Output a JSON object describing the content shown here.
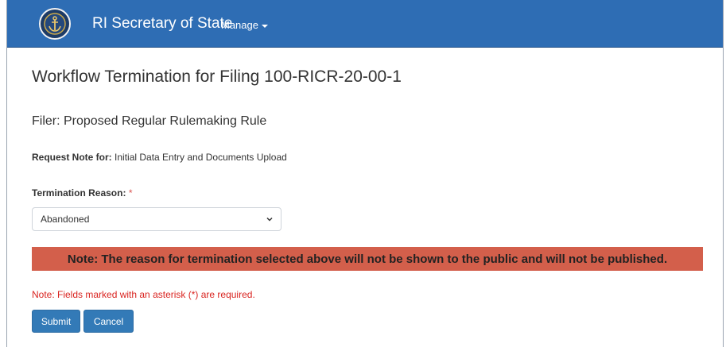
{
  "navbar": {
    "brand": "RI Secretary of State",
    "manage_label": "Manage"
  },
  "page": {
    "title": "Workflow Termination for Filing 100-RICR-20-00-1",
    "filer": "Filer: Proposed Regular Rulemaking Rule",
    "request_note_label": "Request Note for:",
    "request_note_value": "Initial Data Entry and Documents Upload"
  },
  "form": {
    "termination_reason_label": "Termination Reason:",
    "required_marker": "*",
    "termination_reason_value": "Abandoned",
    "alert_text": "Note: The reason for termination selected above will not be shown to the public and will not be published.",
    "required_note": "Note: Fields marked with an asterisk (*) are required.",
    "submit_label": "Submit",
    "cancel_label": "Cancel"
  },
  "colors": {
    "navbar": "#2e6db4",
    "alert_bg": "#d35f4b",
    "primary_button": "#337ab7",
    "required_text": "#d9231f"
  },
  "icons": {
    "logo": "anchor-seal-icon",
    "manage_dropdown": "caret-down-icon",
    "select_dropdown": "chevron-down-icon"
  }
}
